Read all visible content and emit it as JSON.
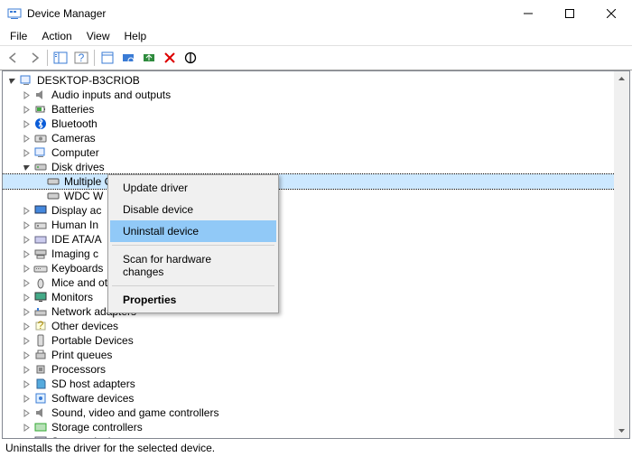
{
  "window": {
    "title": "Device Manager"
  },
  "menu": {
    "file": "File",
    "action": "Action",
    "view": "View",
    "help": "Help"
  },
  "tree": {
    "root": "DESKTOP-B3CRIOB",
    "items": [
      {
        "label": "Audio inputs and outputs",
        "expanded": false
      },
      {
        "label": "Batteries",
        "expanded": false
      },
      {
        "label": "Bluetooth",
        "expanded": false
      },
      {
        "label": "Cameras",
        "expanded": false
      },
      {
        "label": "Computer",
        "expanded": false
      },
      {
        "label": "Disk drives",
        "expanded": true,
        "children": [
          {
            "label": "Multiple Card Reader USB Devi...",
            "selected": true
          },
          {
            "label": "WDC W"
          }
        ]
      },
      {
        "label": "Display ac",
        "expanded": false
      },
      {
        "label": "Human In",
        "expanded": false
      },
      {
        "label": "IDE ATA/A",
        "expanded": false
      },
      {
        "label": "Imaging c",
        "expanded": false
      },
      {
        "label": "Keyboards",
        "expanded": false
      },
      {
        "label": "Mice and other pointing devices",
        "expanded": false
      },
      {
        "label": "Monitors",
        "expanded": false
      },
      {
        "label": "Network adapters",
        "expanded": false
      },
      {
        "label": "Other devices",
        "expanded": false
      },
      {
        "label": "Portable Devices",
        "expanded": false
      },
      {
        "label": "Print queues",
        "expanded": false
      },
      {
        "label": "Processors",
        "expanded": false
      },
      {
        "label": "SD host adapters",
        "expanded": false
      },
      {
        "label": "Software devices",
        "expanded": false
      },
      {
        "label": "Sound, video and game controllers",
        "expanded": false
      },
      {
        "label": "Storage controllers",
        "expanded": false
      },
      {
        "label": "System devices",
        "expanded": false
      }
    ]
  },
  "context_menu": {
    "update": "Update driver",
    "disable": "Disable device",
    "uninstall": "Uninstall device",
    "scan": "Scan for hardware changes",
    "properties": "Properties"
  },
  "status": "Uninstalls the driver for the selected device."
}
